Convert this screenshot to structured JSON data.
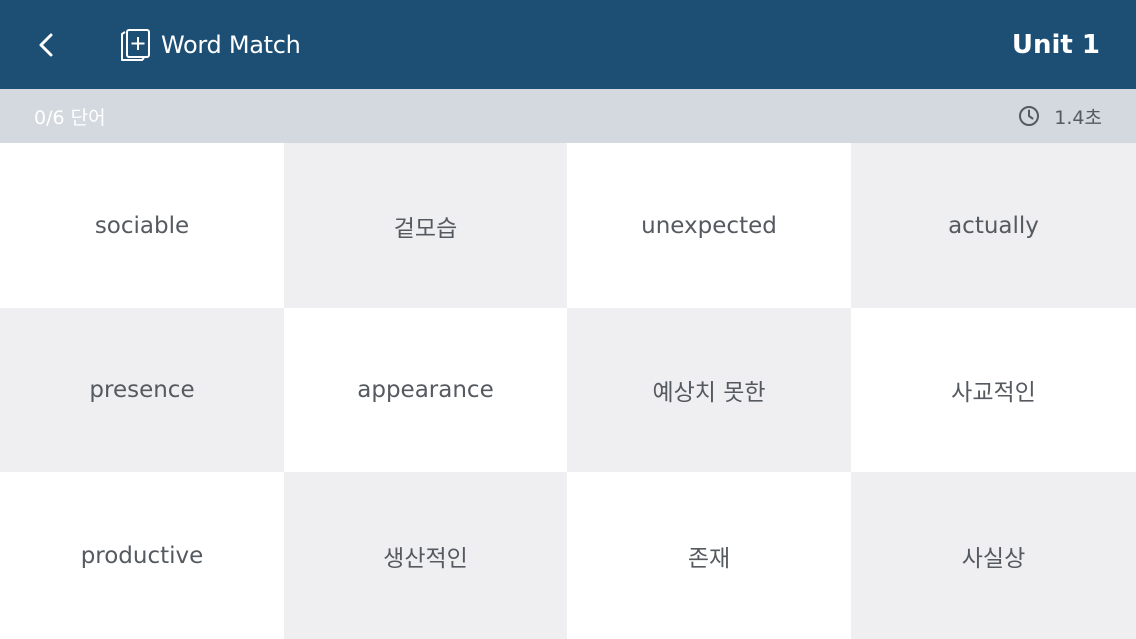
{
  "header": {
    "title": "Word Match",
    "unit": "Unit 1",
    "back_icon": "chevron-left-icon",
    "brand_icon": "flashcard-add-icon"
  },
  "status": {
    "progress": "0/6 단어",
    "time": "1.4초",
    "timer_icon": "clock-icon"
  },
  "cards": [
    "sociable",
    "겉모습",
    "unexpected",
    "actually",
    "presence",
    "appearance",
    "예상치 못한",
    "사교적인",
    "productive",
    "생산적인",
    "존재",
    "사실상"
  ],
  "colors": {
    "header_bg": "#1d4e74",
    "status_bg": "#d3d9df",
    "card_light": "#ffffff",
    "card_shade": "#efeff1",
    "card_text": "#555a60"
  }
}
